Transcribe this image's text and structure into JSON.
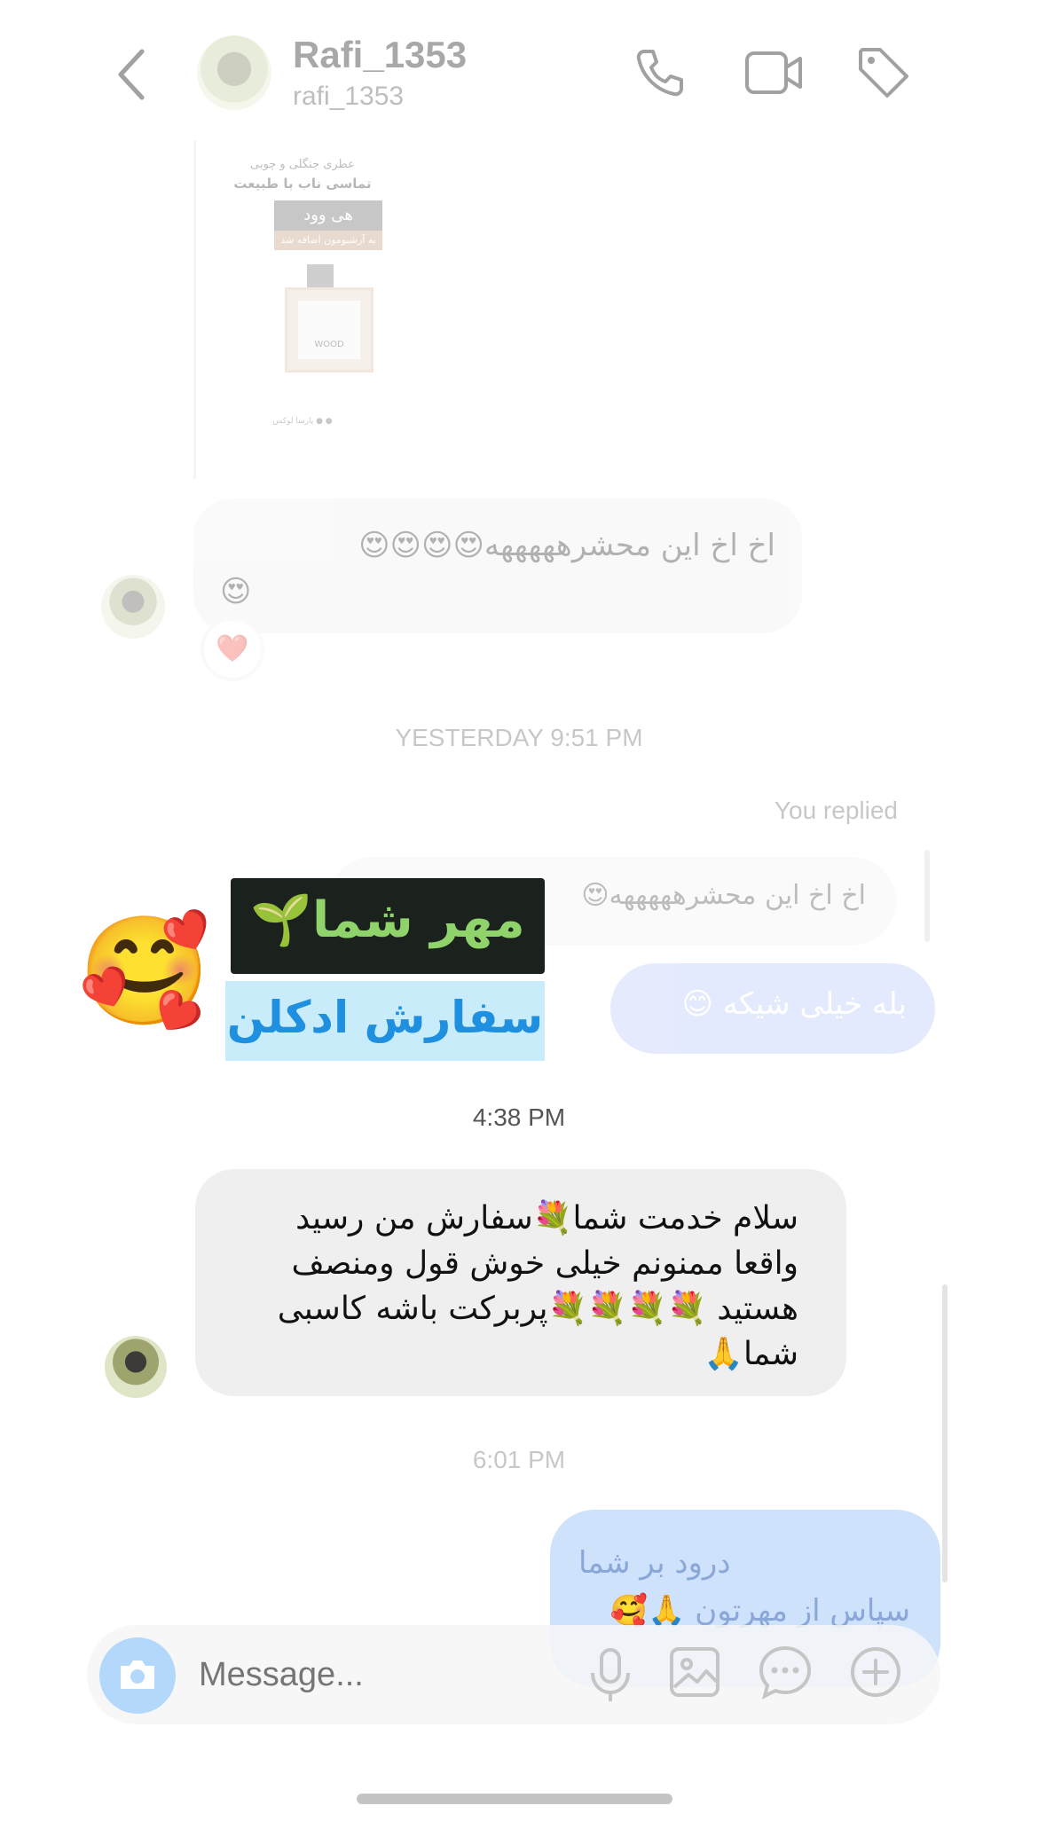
{
  "header": {
    "display_name": "Rafi_1353",
    "username": "rafi_1353",
    "icons": [
      "back-icon",
      "phone-icon",
      "video-icon",
      "tag-icon"
    ]
  },
  "shared_post": {
    "line1": "عطری جنگلی و چوبی",
    "line2": "تماسی ناب با طبیعت",
    "brand": "هی وود",
    "badge": "به آرشیومون اضافه شد",
    "bottle_label": "WOOD",
    "footer": "● ● پارسا لوکس"
  },
  "messages": {
    "msg1_text": "اخ اخ این محشرهههههه",
    "msg1_emoji_row1": "😍😍😍😍",
    "msg1_emoji_row2": "😍",
    "msg1_reaction": "❤️",
    "ts_yesterday": "YESTERDAY 9:51 PM",
    "you_replied": "You replied",
    "replied_quote": "اخ اخ این محشرهههههه😍",
    "my_reply": "بله خیلی شیکه 😊",
    "ts_438": "4:38 PM",
    "msg2_text": "سلام خدمت شما💐سفارش من رسید واقعا ممنونم خیلی خوش قول ومنصف هستید 💐💐💐💐پربرکت باشه کاسبی شما🙏",
    "ts_601": "6:01 PM",
    "my_msg2_line1": "درود بر شما",
    "my_msg2_line2": "سپاس از مهرتون 🙏🥰"
  },
  "overlay": {
    "sticker_dark_text": "مهر شما🌱",
    "sticker_blue_text": "سفارش ادکلن",
    "emoji_sticker": "🥰"
  },
  "composer": {
    "placeholder": "Message...",
    "icons": [
      "camera-icon",
      "microphone-icon",
      "gallery-icon",
      "sticker-chat-icon",
      "plus-icon"
    ]
  },
  "colors": {
    "accent_blue": "#3797f0",
    "my_bubble": "#dbe5fb",
    "their_bubble": "#efefef",
    "sticker_dark": "#1b221e",
    "sticker_green_text": "#8fd36a",
    "sticker_blue_bg": "#c9ecfb",
    "sticker_blue_text": "#1f8fe0"
  }
}
